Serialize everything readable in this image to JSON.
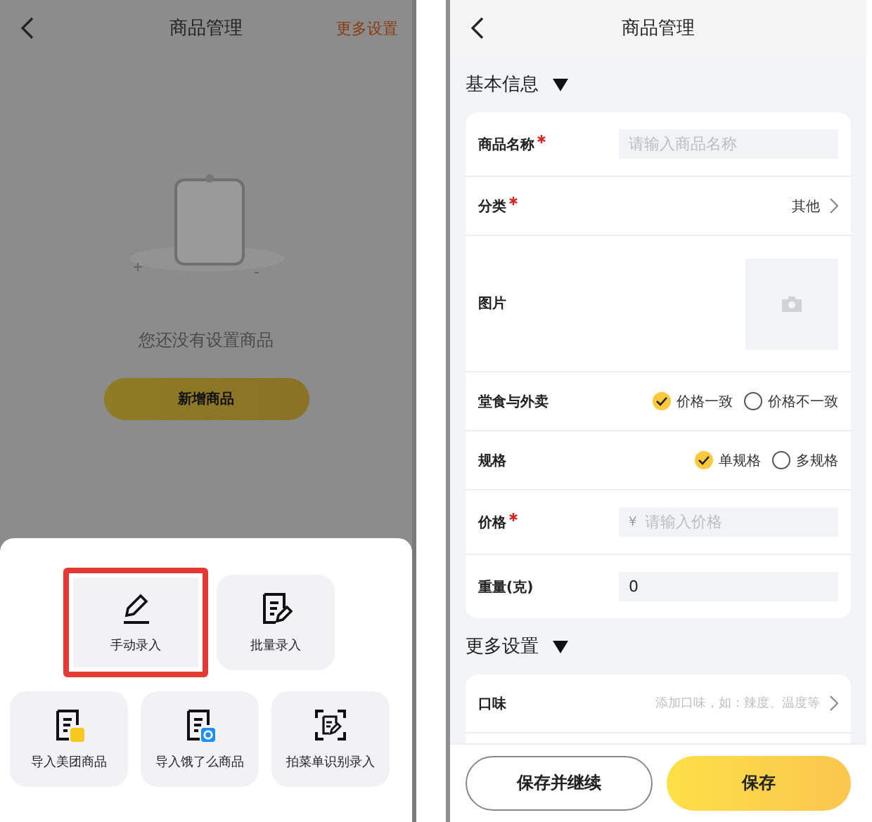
{
  "left_screen": {
    "title": "商品管理",
    "more_link": "更多设置",
    "empty_text": "您还没有设置商品",
    "add_button": "新增商品",
    "sheet": {
      "rows": [
        [
          {
            "label": "手动录入",
            "kind": "pen",
            "selected": true
          },
          {
            "label": "批量录入",
            "kind": "batch",
            "selected": false
          }
        ],
        [
          {
            "label": "导入美团商品",
            "kind": "meituan",
            "selected": false
          },
          {
            "label": "导入饿了么商品",
            "kind": "eleme",
            "selected": false
          },
          {
            "label": "拍菜单识别录入",
            "kind": "scan",
            "selected": false
          }
        ]
      ]
    }
  },
  "right_screen": {
    "title": "商品管理",
    "sections": [
      {
        "title": "基本信息",
        "expanded": true,
        "rows": [
          {
            "kind": "input",
            "label": "商品名称",
            "required": true,
            "placeholder": "请输入商品名称"
          },
          {
            "kind": "select",
            "label": "分类",
            "required": true,
            "value": "其他"
          },
          {
            "kind": "image",
            "label": "图片",
            "required": false
          },
          {
            "kind": "radio",
            "label": "堂食与外卖",
            "required": false,
            "options": [
              {
                "label": "价格一致",
                "selected": true
              },
              {
                "label": "价格不一致",
                "selected": false
              }
            ]
          },
          {
            "kind": "radio",
            "label": "规格",
            "required": false,
            "options": [
              {
                "label": "单规格",
                "selected": true
              },
              {
                "label": "多规格",
                "selected": false
              }
            ]
          },
          {
            "kind": "input",
            "label": "价格",
            "required": true,
            "prefix": "¥",
            "placeholder": "请输入价格"
          },
          {
            "kind": "input",
            "label": "重量(克)",
            "required": false,
            "value": "0"
          }
        ]
      },
      {
        "title": "更多设置",
        "expanded": true,
        "rows": [
          {
            "kind": "select",
            "label": "口味",
            "required": false,
            "placeholder": "添加口味，如：辣度、温度等"
          },
          {
            "kind": "blank"
          }
        ]
      }
    ],
    "buttons": [
      {
        "label": "保存并继续",
        "primary": false
      },
      {
        "label": "保存",
        "primary": true
      }
    ]
  }
}
